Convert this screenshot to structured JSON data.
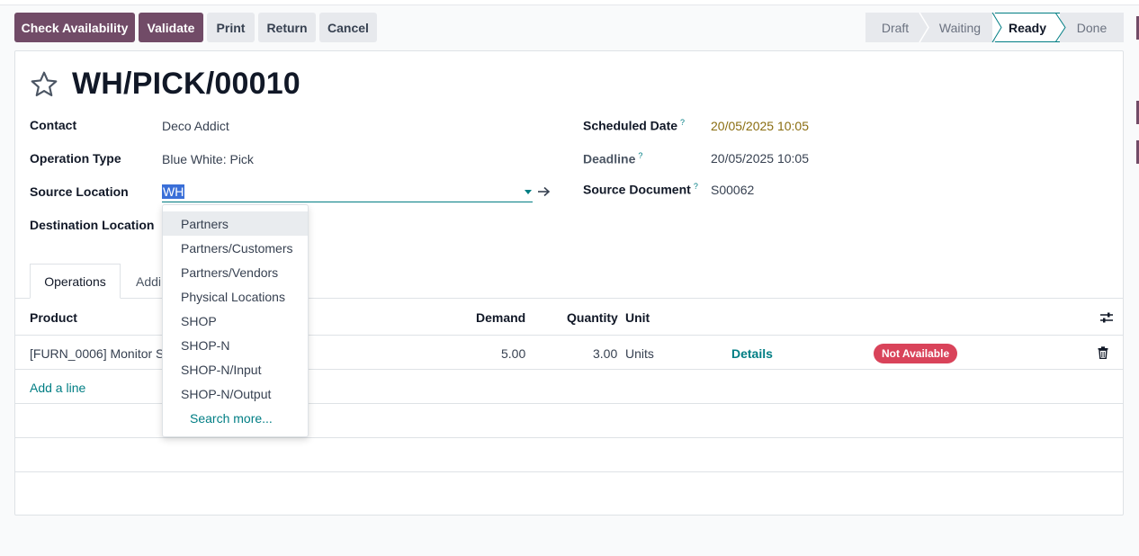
{
  "control_panel": {
    "buttons": [
      {
        "label": "Check Availability",
        "style": "primary"
      },
      {
        "label": "Validate",
        "style": "primary"
      },
      {
        "label": "Print",
        "style": "secondary"
      },
      {
        "label": "Return",
        "style": "secondary"
      },
      {
        "label": "Cancel",
        "style": "secondary"
      }
    ],
    "statusbar": {
      "stages": [
        "Draft",
        "Waiting",
        "Ready",
        "Done"
      ],
      "active": "Ready"
    }
  },
  "record": {
    "title": "WH/PICK/00010",
    "favorite_icon": "star-outline-icon"
  },
  "fields_left": {
    "contact": {
      "label": "Contact",
      "value": "Deco Addict"
    },
    "operation_type": {
      "label": "Operation Type",
      "value": "Blue White: Pick"
    },
    "source_location": {
      "label": "Source Location",
      "value": "WH"
    },
    "destination_location": {
      "label": "Destination Location"
    }
  },
  "fields_right": {
    "scheduled_date": {
      "label": "Scheduled Date",
      "help": "?",
      "value": "20/05/2025 10:05"
    },
    "deadline": {
      "label": "Deadline",
      "help": "?",
      "value": "20/05/2025 10:05"
    },
    "source_document": {
      "label": "Source Document",
      "help": "?",
      "value": "S00062"
    }
  },
  "tabs": [
    {
      "label": "Operations",
      "active": true
    },
    {
      "label": "Addi",
      "active": false
    }
  ],
  "table": {
    "headers": {
      "product": "Product",
      "demand": "Demand",
      "quantity": "Quantity",
      "unit": "Unit"
    },
    "rows": [
      {
        "product": "[FURN_0006] Monitor St",
        "demand": "5.00",
        "quantity": "3.00",
        "unit": "Units",
        "details": "Details",
        "status": "Not Available"
      }
    ],
    "add_line": "Add a line"
  },
  "dropdown": {
    "items": [
      "Partners",
      "Partners/Customers",
      "Partners/Vendors",
      "Physical Locations",
      "SHOP",
      "SHOP-N",
      "SHOP-N/Input",
      "SHOP-N/Output"
    ],
    "highlighted": "Partners",
    "search_more": "Search more..."
  },
  "colors": {
    "primary": "#714b67",
    "accent": "#017e84",
    "danger": "#d9435a",
    "warning_text": "#8a6d10"
  }
}
